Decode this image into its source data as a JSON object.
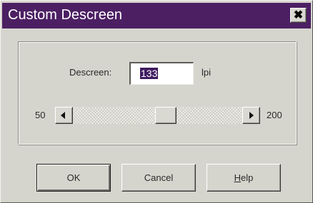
{
  "dialog": {
    "title": "Custom Descreen",
    "close_glyph": "✖",
    "colors": {
      "titlebar": "#4c1f63",
      "face": "#d6d5cd",
      "selection": "#3f1b5f"
    }
  },
  "descreen": {
    "label": "Descreen:",
    "value": "133",
    "unit": "lpi"
  },
  "slider": {
    "min_label": "50",
    "max_label": "200",
    "min": 50,
    "max": 200,
    "value": 133,
    "left_icon": "scroll-left-arrow",
    "right_icon": "scroll-right-arrow"
  },
  "buttons": {
    "ok": "OK",
    "cancel": "Cancel",
    "help_mnemonic": "H",
    "help_rest": "elp"
  }
}
